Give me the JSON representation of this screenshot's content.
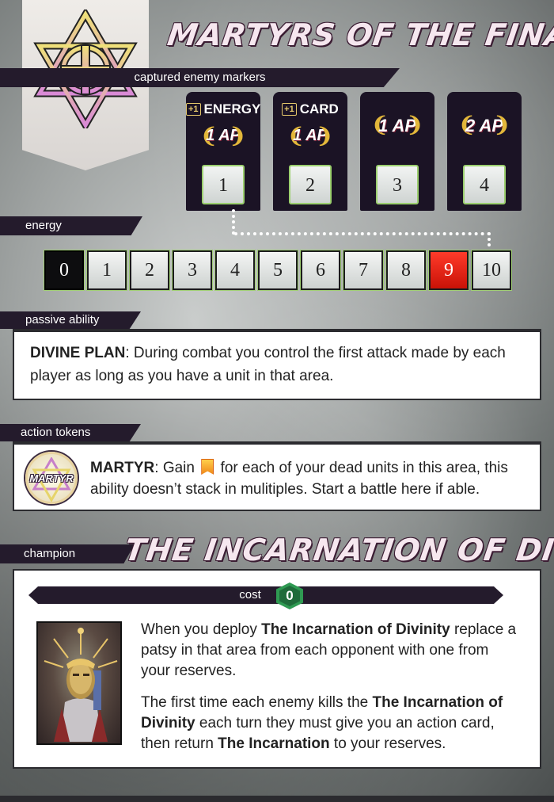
{
  "faction": {
    "title": "MARTYRS OF THE FINAL TRUTH",
    "emblem": "star-cross-emblem-icon"
  },
  "captured": {
    "label": "captured enemy markers",
    "markers": [
      {
        "bonus_plus": "+1",
        "bonus": "ENERGY",
        "ap": "1 AP",
        "number": "1"
      },
      {
        "bonus_plus": "+1",
        "bonus": "CARD",
        "ap": "1 AP",
        "number": "2"
      },
      {
        "bonus_plus": "",
        "bonus": "",
        "ap": "1 AP",
        "number": "3"
      },
      {
        "bonus_plus": "",
        "bonus": "",
        "ap": "2 AP",
        "number": "4"
      }
    ]
  },
  "energy": {
    "label": "energy",
    "cells": [
      "0",
      "1",
      "2",
      "3",
      "4",
      "5",
      "6",
      "7",
      "8",
      "9",
      "10"
    ],
    "highlight_black": "0",
    "highlight_red": "9"
  },
  "passive": {
    "label": "passive ability",
    "name": "DIVINE PLAN",
    "text": ": During combat you control the first attack made by each player as long as you have a unit in that area."
  },
  "action": {
    "label": "action tokens",
    "token_label": "MARTYR",
    "name": "MARTYR",
    "text_before": ": Gain",
    "text_after": "for each of your dead units in this area, this ability doesn’t stack in mulitiples. Start a battle here if able."
  },
  "champion": {
    "label": "champion",
    "title": "THE INCARNATION OF DIVINITY",
    "cost_label": "cost",
    "cost_value": "0",
    "p1_before": "When you deploy ",
    "p1_bold": "The Incarnation of Divinity",
    "p1_after": " replace a patsy in that area from each opponent with one from your reserves.",
    "p2_a": "The first time each enemy kills the ",
    "p2_bold1": "The Incarnation of Divinity",
    "p2_b": " each turn they must give you an action card, then return ",
    "p2_bold2": "The Incarnation",
    "p2_c": " to your reserves."
  },
  "colors": {
    "bar": "#241b2c",
    "energy_red": "#e0180b",
    "cost_green": "#2f9a52",
    "laurel_gold": "#e3b73a"
  }
}
